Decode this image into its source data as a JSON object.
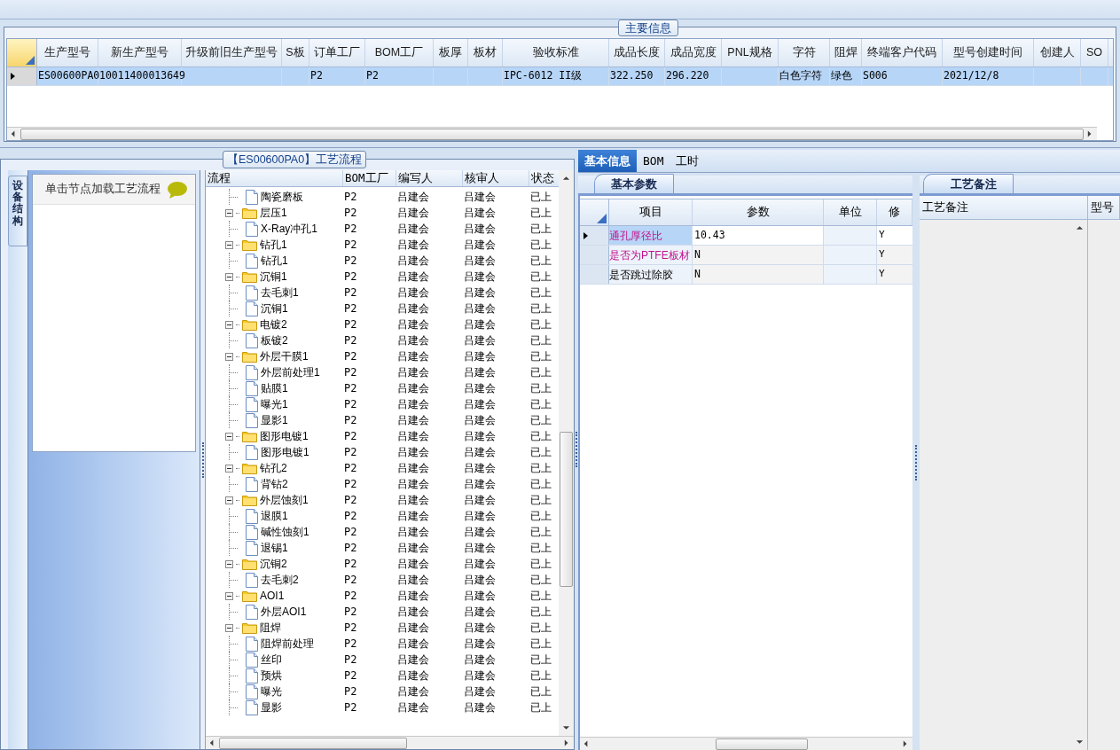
{
  "main_info": {
    "title": "主要信息",
    "columns": [
      "生产型号",
      "新生产型号",
      "升级前旧生产型号",
      "S板",
      "订单工厂",
      "BOM工厂",
      "板厚",
      "板材",
      "验收标准",
      "成品长度",
      "成品宽度",
      "PNL规格",
      "字符",
      "阻焊",
      "终端客户代码",
      "型号创建时间",
      "创建人",
      "SO"
    ],
    "rows": [
      {
        "selected": true,
        "cells": [
          "ES00600PA0",
          "10011400013649",
          null,
          null,
          "P2",
          "P2",
          null,
          null,
          "IPC-6012 II级",
          "322.250",
          "296.220",
          null,
          "白色字符",
          "绿色",
          "S006",
          "2021/12/8",
          null,
          null
        ]
      }
    ]
  },
  "process": {
    "title": "【ES00600PA0】工艺流程",
    "side_tab": "设备结构",
    "hint": "单击节点加载工艺流程",
    "columns": [
      "流程",
      "BOM工厂",
      "编写人",
      "核审人",
      "状态"
    ],
    "nodes": [
      {
        "children": [
          {
            "label": "陶瓷磨板",
            "bom": "P2",
            "author": "吕建会",
            "reviewer": "吕建会",
            "status": "已上"
          }
        ]
      },
      {
        "label": "层压1",
        "expanded": true,
        "bom": "P2",
        "author": "吕建会",
        "reviewer": "吕建会",
        "status": "已上",
        "children": [
          {
            "label": "X-Ray冲孔1",
            "bom": "P2",
            "author": "吕建会",
            "reviewer": "吕建会",
            "status": "已上"
          }
        ]
      },
      {
        "label": "钻孔1",
        "expanded": true,
        "bom": "P2",
        "author": "吕建会",
        "reviewer": "吕建会",
        "status": "已上",
        "children": [
          {
            "label": "钻孔1",
            "bom": "P2",
            "author": "吕建会",
            "reviewer": "吕建会",
            "status": "已上"
          }
        ]
      },
      {
        "label": "沉铜1",
        "expanded": true,
        "bom": "P2",
        "author": "吕建会",
        "reviewer": "吕建会",
        "status": "已上",
        "children": [
          {
            "label": "去毛刺1",
            "bom": "P2",
            "author": "吕建会",
            "reviewer": "吕建会",
            "status": "已上"
          },
          {
            "label": "沉铜1",
            "bom": "P2",
            "author": "吕建会",
            "reviewer": "吕建会",
            "status": "已上"
          }
        ]
      },
      {
        "label": "电镀2",
        "expanded": true,
        "bom": "P2",
        "author": "吕建会",
        "reviewer": "吕建会",
        "status": "已上",
        "children": [
          {
            "label": "板镀2",
            "bom": "P2",
            "author": "吕建会",
            "reviewer": "吕建会",
            "status": "已上"
          }
        ]
      },
      {
        "label": "外层干膜1",
        "expanded": true,
        "bom": "P2",
        "author": "吕建会",
        "reviewer": "吕建会",
        "status": "已上",
        "children": [
          {
            "label": "外层前处理1",
            "bom": "P2",
            "author": "吕建会",
            "reviewer": "吕建会",
            "status": "已上"
          },
          {
            "label": "贴膜1",
            "bom": "P2",
            "author": "吕建会",
            "reviewer": "吕建会",
            "status": "已上"
          },
          {
            "label": "曝光1",
            "bom": "P2",
            "author": "吕建会",
            "reviewer": "吕建会",
            "status": "已上"
          },
          {
            "label": "显影1",
            "bom": "P2",
            "author": "吕建会",
            "reviewer": "吕建会",
            "status": "已上"
          }
        ]
      },
      {
        "label": "图形电镀1",
        "expanded": true,
        "bom": "P2",
        "author": "吕建会",
        "reviewer": "吕建会",
        "status": "已上",
        "children": [
          {
            "label": "图形电镀1",
            "bom": "P2",
            "author": "吕建会",
            "reviewer": "吕建会",
            "status": "已上"
          }
        ]
      },
      {
        "label": "钻孔2",
        "expanded": true,
        "bom": "P2",
        "author": "吕建会",
        "reviewer": "吕建会",
        "status": "已上",
        "children": [
          {
            "label": "背钻2",
            "bom": "P2",
            "author": "吕建会",
            "reviewer": "吕建会",
            "status": "已上"
          }
        ]
      },
      {
        "label": "外层蚀刻1",
        "expanded": true,
        "bom": "P2",
        "author": "吕建会",
        "reviewer": "吕建会",
        "status": "已上",
        "children": [
          {
            "label": "退膜1",
            "bom": "P2",
            "author": "吕建会",
            "reviewer": "吕建会",
            "status": "已上"
          },
          {
            "label": "碱性蚀刻1",
            "bom": "P2",
            "author": "吕建会",
            "reviewer": "吕建会",
            "status": "已上"
          },
          {
            "label": "退锡1",
            "bom": "P2",
            "author": "吕建会",
            "reviewer": "吕建会",
            "status": "已上"
          }
        ]
      },
      {
        "label": "沉铜2",
        "expanded": true,
        "bom": "P2",
        "author": "吕建会",
        "reviewer": "吕建会",
        "status": "已上",
        "children": [
          {
            "label": "去毛刺2",
            "bom": "P2",
            "author": "吕建会",
            "reviewer": "吕建会",
            "status": "已上"
          }
        ]
      },
      {
        "label": "AOI1",
        "expanded": true,
        "bom": "P2",
        "author": "吕建会",
        "reviewer": "吕建会",
        "status": "已上",
        "children": [
          {
            "label": "外层AOI1",
            "bom": "P2",
            "author": "吕建会",
            "reviewer": "吕建会",
            "status": "已上"
          }
        ]
      },
      {
        "label": "阻焊",
        "expanded": true,
        "bom": "P2",
        "author": "吕建会",
        "reviewer": "吕建会",
        "status": "已上",
        "children": [
          {
            "label": "阻焊前处理",
            "bom": "P2",
            "author": "吕建会",
            "reviewer": "吕建会",
            "status": "已上"
          },
          {
            "label": "丝印",
            "bom": "P2",
            "author": "吕建会",
            "reviewer": "吕建会",
            "status": "已上"
          },
          {
            "label": "预烘",
            "bom": "P2",
            "author": "吕建会",
            "reviewer": "吕建会",
            "status": "已上"
          },
          {
            "label": "曝光",
            "bom": "P2",
            "author": "吕建会",
            "reviewer": "吕建会",
            "status": "已上"
          },
          {
            "label": "显影",
            "bom": "P2",
            "author": "吕建会",
            "reviewer": "吕建会",
            "status": "已上"
          }
        ]
      }
    ]
  },
  "detail": {
    "tabs": [
      {
        "label": "基本信息",
        "selected": true
      },
      {
        "label": "BOM",
        "selected": false
      },
      {
        "label": "工时",
        "selected": false
      }
    ],
    "params": {
      "title": "基本参数",
      "columns": [
        "项目",
        "参数",
        "单位",
        "修"
      ],
      "rows": [
        {
          "selected": true,
          "emphasis": true,
          "item": "通孔厚径比",
          "value": "10.43",
          "modified": "Y"
        },
        {
          "selected": false,
          "emphasis": true,
          "item": "是否为PTFE板材",
          "value": "N",
          "modified": "Y"
        },
        {
          "selected": false,
          "emphasis": false,
          "item": "是否跳过除胶",
          "value": "N",
          "modified": "Y"
        }
      ]
    },
    "remarks": {
      "title": "工艺备注",
      "columns": [
        "工艺备注",
        "型号"
      ]
    }
  }
}
